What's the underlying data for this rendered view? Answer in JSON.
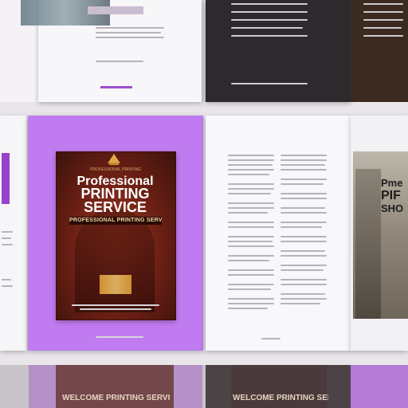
{
  "cover": {
    "caption": "PROFESSIONAL PRINTING",
    "title_line_1": "Professional",
    "title_line_2": "PRINTING",
    "title_line_3": "SERVICE",
    "band_text": "PROFESSIONAL PRINTING SERVICE"
  },
  "right_cover": {
    "line_1": "Pme",
    "line_2": "PIF",
    "line_3": "SHO"
  },
  "bottom": {
    "text_1": "WELCOME PRINTING SERVICE",
    "text_2": "WELCOME PRINTING SERVICE"
  },
  "colors": {
    "accent_purple": "#c07bf0",
    "cover_red": "#6a1f14"
  },
  "icons": {
    "crest": "temple-crest-icon"
  }
}
